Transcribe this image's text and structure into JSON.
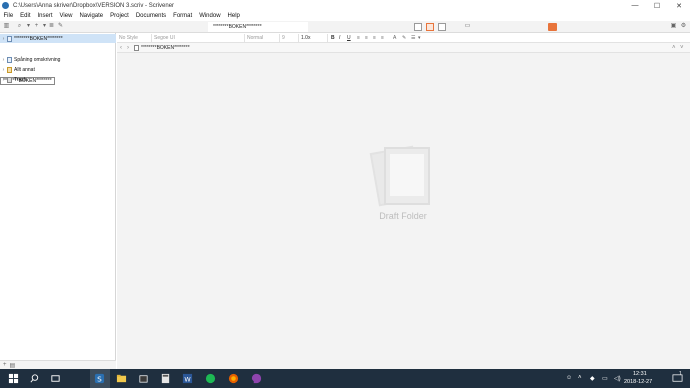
{
  "window": {
    "title": "C:\\Users\\Anna skriver\\Dropbox\\VERSION 3.scriv - Scrivener",
    "min_label": "—",
    "max_label": "☐",
    "close_label": "✕"
  },
  "menu": [
    "File",
    "Edit",
    "Insert",
    "View",
    "Navigate",
    "Project",
    "Documents",
    "Format",
    "Window",
    "Help"
  ],
  "toolbar": {
    "doc_title": "********BOKEN********"
  },
  "binder": {
    "items": [
      {
        "label": "********BOKEN********",
        "icon": "document-icon",
        "selected": true
      },
      {
        "label": "Spåning omskrivning",
        "icon": "document-icon",
        "selected": false
      },
      {
        "label": "Allt annat",
        "icon": "folder-icon",
        "selected": false
      },
      {
        "label": "Trash",
        "icon": "trash-icon",
        "selected": false
      }
    ],
    "tooltip": "********BOKEN********",
    "footer_add": "+",
    "footer_folder": "▤"
  },
  "formatbar": {
    "style": "No Style",
    "font": "Segoe UI",
    "weight": "Normal",
    "size": "9",
    "spacing": "1.0x",
    "bold": "B",
    "italic": "I",
    "underline": "U"
  },
  "editor": {
    "doc_title": "********BOKEN********",
    "empty_label": "Draft Folder"
  },
  "taskbar": {
    "time": "12:31",
    "date": "2018-12-27",
    "notification_count": "1"
  },
  "colors": {
    "accent": "#e8743b",
    "selection": "#cfe3f7",
    "taskbar": "#1f2f3f"
  }
}
